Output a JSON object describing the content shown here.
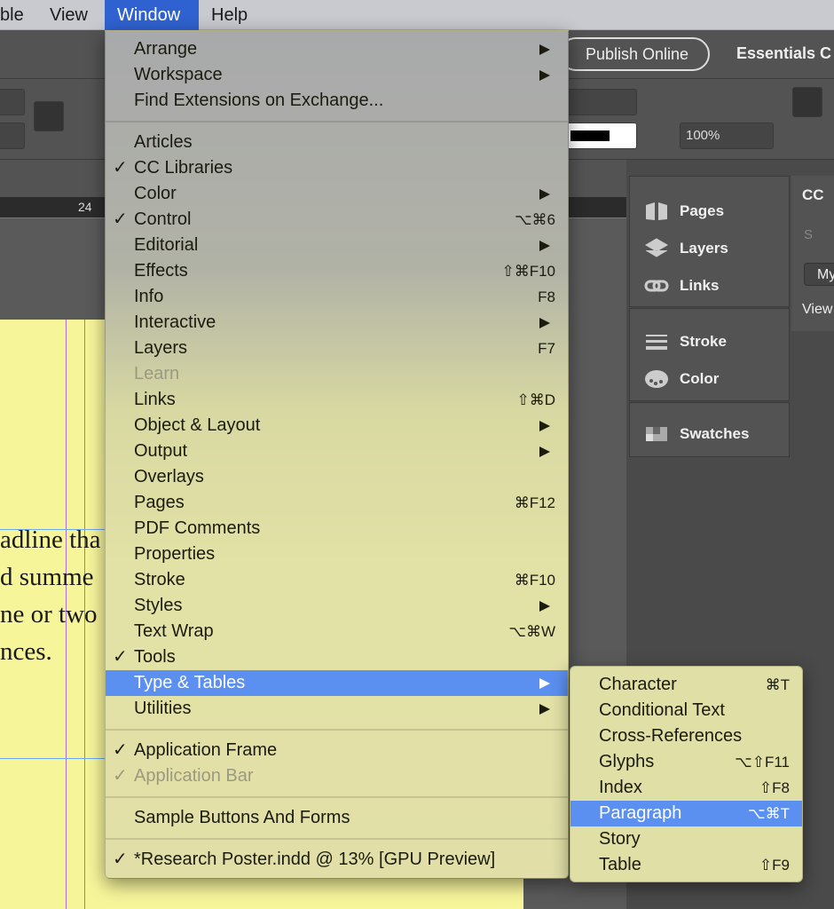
{
  "menubar": {
    "items": [
      {
        "label": "ble"
      },
      {
        "label": "View"
      },
      {
        "label": "Window",
        "active": true
      },
      {
        "label": "Help"
      }
    ]
  },
  "appbar": {
    "publish": "Publish Online",
    "workspace": "Essentials C"
  },
  "control": {
    "opacity": "100%"
  },
  "ruler": {
    "tick": "24"
  },
  "document": {
    "lines": [
      "adline tha",
      "d summe",
      "ne or two",
      "nces."
    ]
  },
  "panels": {
    "items": [
      {
        "label": "Pages",
        "icon": "pages-icon"
      },
      {
        "label": "Layers",
        "icon": "layers-icon"
      },
      {
        "label": "Links",
        "icon": "links-icon"
      },
      {
        "label": "Stroke",
        "icon": "stroke-icon"
      },
      {
        "label": "Color",
        "icon": "palette-icon"
      },
      {
        "label": "Swatches",
        "icon": "swatches-icon"
      }
    ],
    "cc": {
      "title": "CC",
      "search_placeholder": "S",
      "button": "My",
      "view": "View"
    }
  },
  "window_menu": {
    "items": [
      {
        "label": "Arrange",
        "submenu": true
      },
      {
        "label": "Workspace",
        "submenu": true
      },
      {
        "label": "Find Extensions on Exchange..."
      },
      {
        "sep": true
      },
      {
        "label": "Articles"
      },
      {
        "label": "CC Libraries",
        "checked": true
      },
      {
        "label": "Color",
        "submenu": true
      },
      {
        "label": "Control",
        "checked": true,
        "shortcut": "⌥⌘6"
      },
      {
        "label": "Editorial",
        "submenu": true
      },
      {
        "label": "Effects",
        "shortcut": "⇧⌘F10"
      },
      {
        "label": "Info",
        "shortcut": "F8"
      },
      {
        "label": "Interactive",
        "submenu": true
      },
      {
        "label": "Layers",
        "shortcut": "F7"
      },
      {
        "label": "Learn",
        "disabled": true
      },
      {
        "label": "Links",
        "shortcut": "⇧⌘D"
      },
      {
        "label": "Object & Layout",
        "submenu": true
      },
      {
        "label": "Output",
        "submenu": true
      },
      {
        "label": "Overlays"
      },
      {
        "label": "Pages",
        "shortcut": "⌘F12"
      },
      {
        "label": "PDF Comments"
      },
      {
        "label": "Properties"
      },
      {
        "label": "Stroke",
        "shortcut": "⌘F10"
      },
      {
        "label": "Styles",
        "submenu": true
      },
      {
        "label": "Text Wrap",
        "shortcut": "⌥⌘W"
      },
      {
        "label": "Tools",
        "checked": true
      },
      {
        "label": "Type & Tables",
        "submenu": true,
        "highlighted": true
      },
      {
        "label": "Utilities",
        "submenu": true
      },
      {
        "sep": true
      },
      {
        "label": "Application Frame",
        "checked": true
      },
      {
        "label": "Application Bar",
        "checked": true,
        "disabled": true
      },
      {
        "sep": true
      },
      {
        "label": "Sample Buttons And Forms"
      },
      {
        "sep": true
      },
      {
        "label": "*Research Poster.indd @ 13% [GPU Preview]",
        "checked": true
      }
    ]
  },
  "type_tables_menu": {
    "items": [
      {
        "label": "Character",
        "shortcut": "⌘T"
      },
      {
        "label": "Conditional Text"
      },
      {
        "label": "Cross-References"
      },
      {
        "label": "Glyphs",
        "shortcut": "⌥⇧F11"
      },
      {
        "label": "Index",
        "shortcut": "⇧F8"
      },
      {
        "label": "Paragraph",
        "shortcut": "⌥⌘T",
        "highlighted": true
      },
      {
        "label": "Story"
      },
      {
        "label": "Table",
        "shortcut": "⇧F9"
      }
    ]
  },
  "colors": {
    "highlight": "#2f62d0",
    "menu_highlight": "#5b8ff0",
    "page": "#f7f59a"
  }
}
